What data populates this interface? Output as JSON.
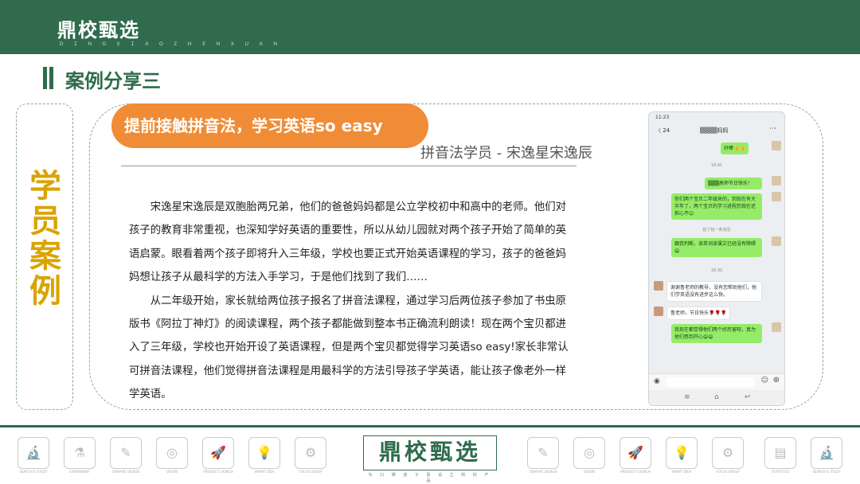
{
  "header": {
    "brand": "鼎校甄选",
    "brand_sub": "Ｄ Ｉ Ｎ Ｇ  Ｘ Ｉ Ａ Ｏ  Ｚ Ｈ Ｅ Ｎ  Ｘ Ｕ Ａ Ｎ",
    "accent_color": "#2f6b4c"
  },
  "page_title": "案例分享三",
  "side_label": [
    "学",
    "员",
    "案",
    "例"
  ],
  "case": {
    "headline": "提前接触拼音法，学习英语so easy",
    "student_line": "拼音法学员 - 宋逸星宋逸辰",
    "paragraphs": [
      "宋逸星宋逸辰是双胞胎两兄弟，他们的爸爸妈妈都是公立学校初中和高中的老师。他们对孩子的教育非常重视，也深知学好英语的重要性，所以从幼儿园就对两个孩子开始了简单的英语启蒙。眼看着两个孩子即将升入三年级，学校也要正式开始英语课程的学习，孩子的爸爸妈妈想让孩子从最科学的方法入手学习，于是他们找到了我们……",
      "从二年级开始，家长就给两位孩子报名了拼音法课程，通过学习后两位孩子参加了书虫原版书《阿拉丁神灯》的阅读课程，两个孩子都能做到整本书正确流利朗读！现在两个宝贝都进入了三年级，学校也开始开设了英语课程，但是两个宝贝都觉得学习英语so easy!家长非常认可拼音法课程，他们觉得拼音法课程是用最科学的方法引导孩子学英语，能让孩子像老外一样学英语。"
    ],
    "accent_orange": "#f08c36",
    "side_color": "#d9a400"
  },
  "phone": {
    "status_time": "11:23",
    "back_label": "〈 24",
    "chat_name": "▒▒▒▒妈妈",
    "more_icon": "ellipsis-icon",
    "messages": [
      {
        "from": "other",
        "text": "好棒👍👍"
      },
      {
        "time": "16:41"
      },
      {
        "from": "me",
        "text": "▒▒▒高师节日快乐！"
      },
      {
        "from": "me",
        "text": "你们两个宝贝二年级来的，到现在有大半年了，两个宝贝的学习进程您观在还担心不😊"
      },
      {
        "time": "拍了拍一条消息"
      },
      {
        "from": "me",
        "text": "跟我判断，读单词读课文已经没有障碍😄"
      },
      {
        "time": "16:30"
      },
      {
        "from": "other",
        "text": "谢谢鲁老师的教导，没有您帮助他们，他们学英语没有进步这么快。"
      },
      {
        "from": "other",
        "text": "鲁老师，节日快乐🌹🌹🌹"
      },
      {
        "from": "me",
        "text": "我现在都觉得他们两个好厉害呀，真为他们感到开心😄😄"
      }
    ]
  },
  "footer": {
    "brand": "鼎校甄选",
    "brand_sub": "为 口 碑 孩 子 而 设 立 的 好 产 品",
    "icons": [
      {
        "name": "microscope-icon",
        "glyph": "🔬",
        "caption": "SEARCH & STUDY"
      },
      {
        "name": "flask-icon",
        "glyph": "⚗",
        "caption": "EXPERIMENT"
      },
      {
        "name": "design-board-icon",
        "glyph": "✎",
        "caption": "GRAPHIC DESIGN"
      },
      {
        "name": "target-icon",
        "glyph": "◎",
        "caption": "VISION"
      },
      {
        "name": "rocket-icon",
        "glyph": "🚀",
        "caption": "PRODUCT LAUNCH"
      },
      {
        "name": "bulb-icon",
        "glyph": "💡",
        "caption": "SMART IDEA"
      },
      {
        "name": "gear-icon",
        "glyph": "⚙",
        "caption": "FOCUS GROUP"
      },
      {
        "name": "design-board-icon-2",
        "glyph": "✎",
        "caption": "GRAPHIC DESIGN"
      },
      {
        "name": "target-icon-2",
        "glyph": "◎",
        "caption": "VISION"
      },
      {
        "name": "rocket-icon-2",
        "glyph": "🚀",
        "caption": "PRODUCT LAUNCH"
      },
      {
        "name": "bulb-icon-2",
        "glyph": "💡",
        "caption": "SMART IDEA"
      },
      {
        "name": "gear-icon-2",
        "glyph": "⚙",
        "caption": "FOCUS GROUP"
      },
      {
        "name": "document-icon",
        "glyph": "▤",
        "caption": "STATISTICS"
      },
      {
        "name": "microscope-icon-2",
        "glyph": "🔬",
        "caption": "SEARCH & STUDY"
      }
    ]
  }
}
